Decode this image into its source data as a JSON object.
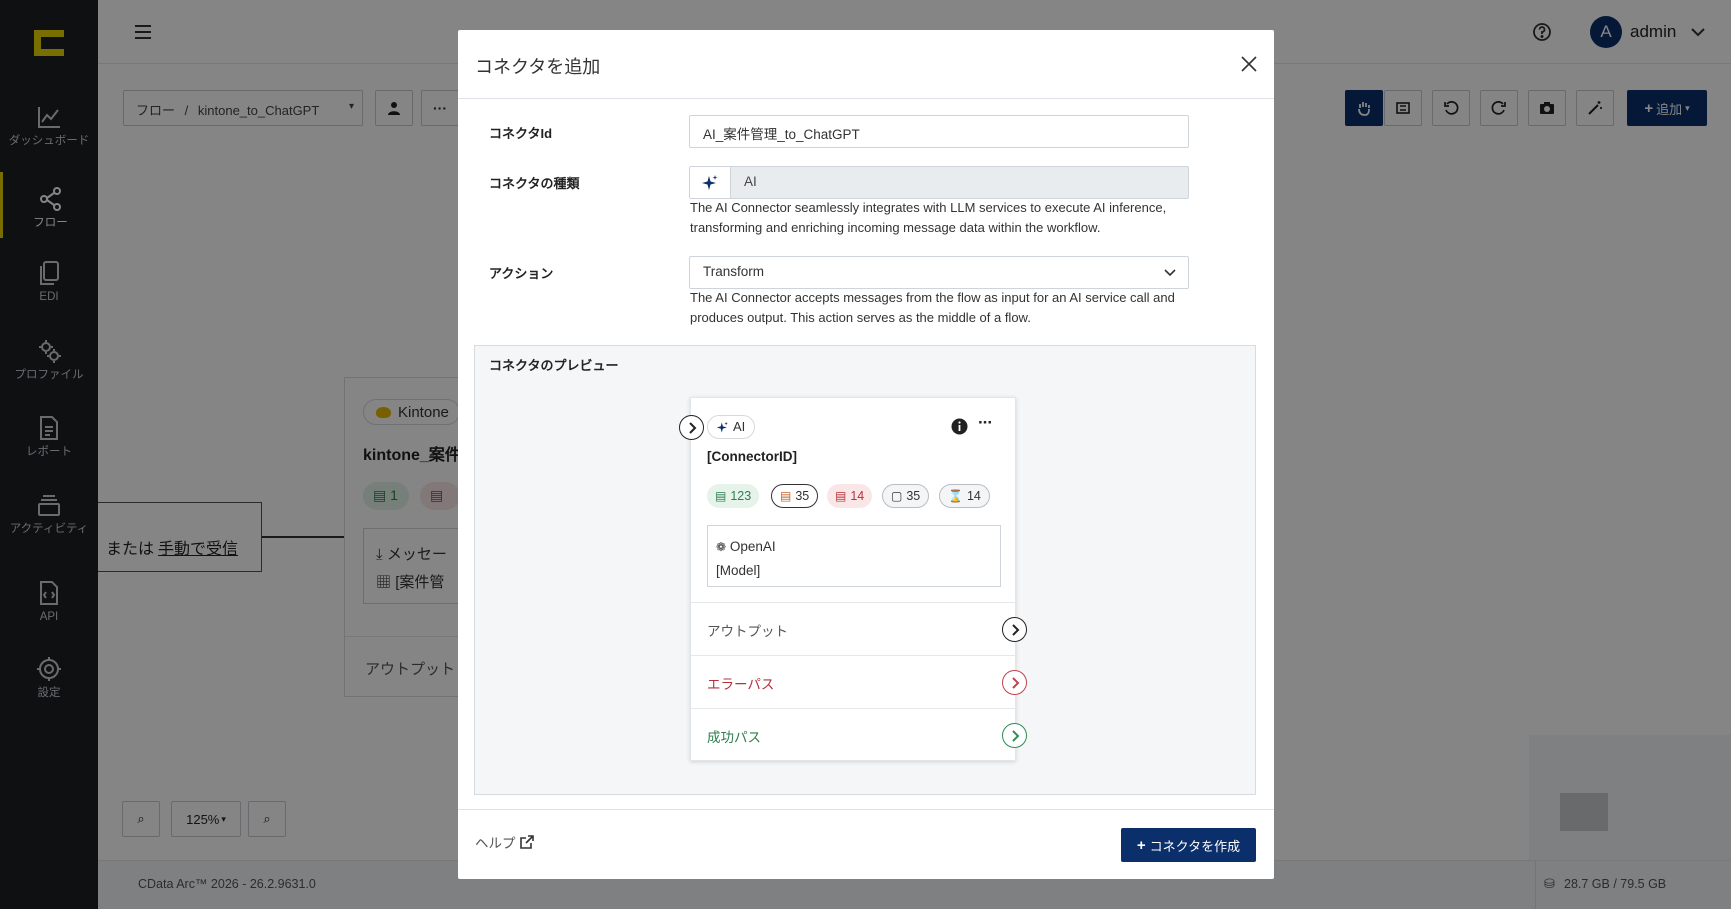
{
  "sidebar": {
    "items": [
      {
        "label": "ダッシュボード",
        "icon": "chart-line-icon"
      },
      {
        "label": "フロー",
        "icon": "share-nodes-icon"
      },
      {
        "label": "EDI",
        "icon": "documents-icon"
      },
      {
        "label": "プロファイル",
        "icon": "gears-icon"
      },
      {
        "label": "レポート",
        "icon": "report-icon"
      },
      {
        "label": "アクティビティ",
        "icon": "layers-icon"
      },
      {
        "label": "API",
        "icon": "api-file-icon"
      },
      {
        "label": "設定",
        "icon": "gear-icon"
      }
    ]
  },
  "topbar": {
    "user_initial": "A",
    "user_name": "admin"
  },
  "flow": {
    "breadcrumb_root": "フロー",
    "breadcrumb_sep": "/",
    "flow_name": "kintone_to_ChatGPT",
    "add_label": "追加",
    "zoom": "125%",
    "node_kintone_tag": "Kintone",
    "node_kintone_title": "kintone_案件",
    "node_badge_1": "1",
    "node_msg": "メッセー",
    "node_table": "[案件管",
    "node_output": "アウトプット",
    "receive_text": "または",
    "receive_link": "手動で受信"
  },
  "footer": {
    "version": "CData Arc™ 2026 - 26.2.9631.0",
    "storage": "28.7 GB / 79.5 GB"
  },
  "modal": {
    "title": "コネクタを追加",
    "connector_id_label": "コネクタId",
    "connector_id_value": "AI_案件管理_to_ChatGPT",
    "connector_type_label": "コネクタの種類",
    "connector_type_value": "AI",
    "connector_type_desc": "The AI Connector seamlessly integrates with LLM services to execute AI inference, transforming and enriching incoming message data within the workflow.",
    "action_label": "アクション",
    "action_value": "Transform",
    "action_desc": "The AI Connector accepts messages from the flow as input for an AI service call and produces output. This action serves as the middle of a flow.",
    "preview_title": "コネクタのプレビュー",
    "help_label": "ヘルプ",
    "create_label": "コネクタを作成"
  },
  "preview_card": {
    "type_label": "AI",
    "connector_id": "[ConnectorID]",
    "badges": [
      "123",
      "35",
      "14",
      "35",
      "14"
    ],
    "provider": "OpenAI",
    "model": "[Model]",
    "paths": [
      {
        "label": "アウトプット",
        "color": "#555555"
      },
      {
        "label": "エラーパス",
        "color": "#b3323b"
      },
      {
        "label": "成功パス",
        "color": "#2e7d4f"
      }
    ]
  },
  "colors": {
    "accent": "#0b2f6b",
    "logo": "#e8d300",
    "sidebar": "#1c1f24"
  }
}
